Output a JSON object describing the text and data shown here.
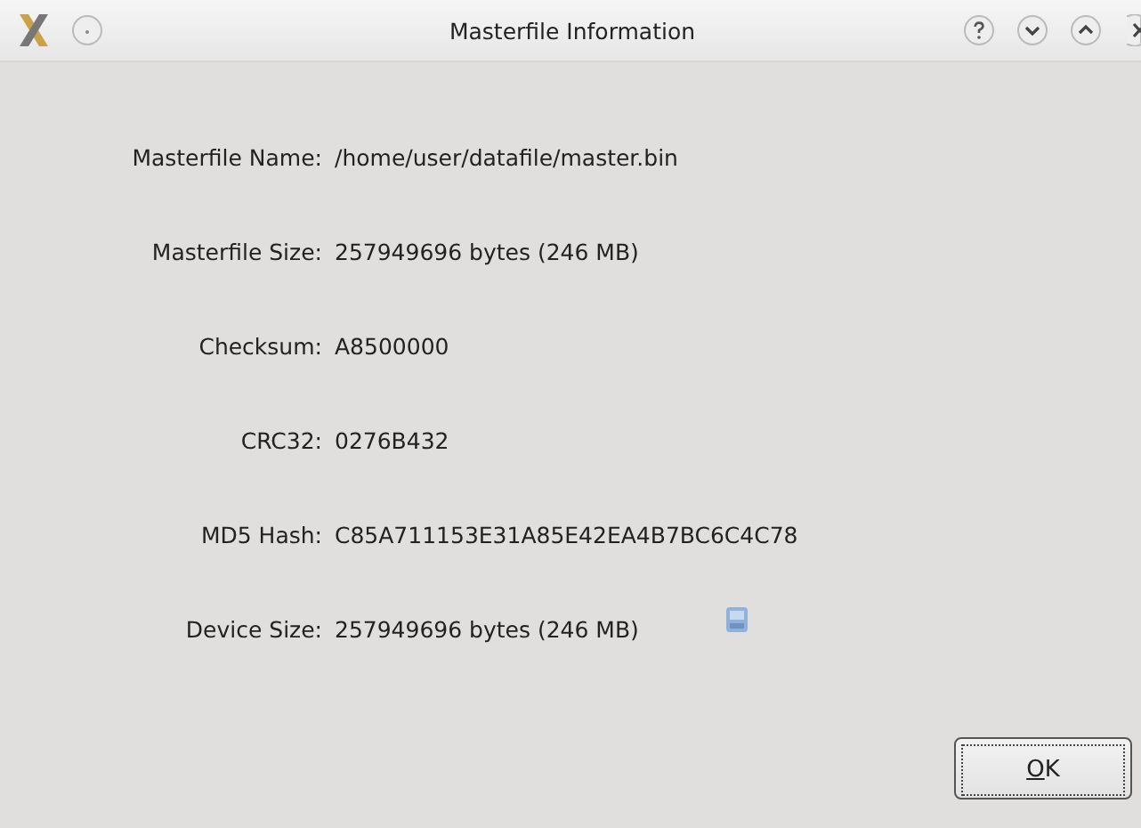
{
  "window": {
    "title": "Masterfile Information"
  },
  "fields": [
    {
      "label": "Masterfile Name:",
      "value": "/home/user/datafile/master.bin",
      "kind": "plain"
    },
    {
      "label": "Masterfile Size:",
      "value": "257949696 bytes (246 MB)",
      "kind": "plain"
    },
    {
      "label": "Checksum:",
      "value": "A8500000",
      "kind": "plain"
    },
    {
      "label": "CRC32:",
      "value": "0276B432",
      "kind": "plain"
    },
    {
      "label": "MD5 Hash:",
      "value": "C85A711153E31A85E42EA4B7BC6C4C78",
      "kind": "plain"
    },
    {
      "label": "Device Size:",
      "value": "257949696 bytes (246 MB)",
      "kind": "device"
    }
  ],
  "buttons": [
    {
      "label": "OK"
    }
  ]
}
